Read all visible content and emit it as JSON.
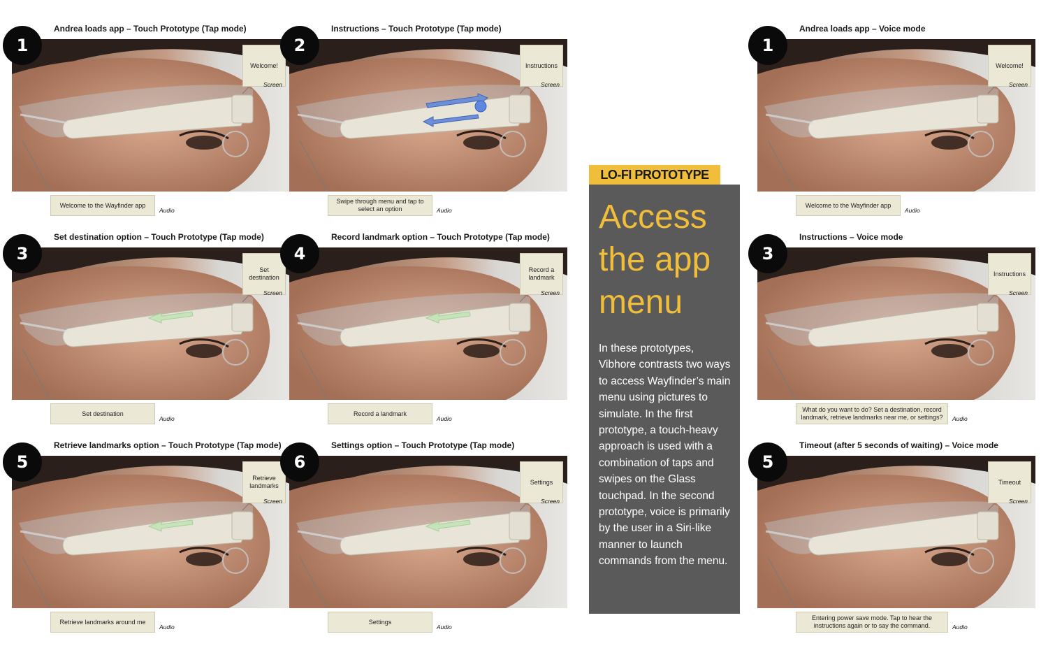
{
  "panels": [
    {
      "step": "1",
      "title": "Andrea loads app – Touch Prototype (Tap mode)",
      "screen": "Welcome!",
      "screen_caption": "Screen",
      "audio": "Welcome to the Wayfinder app",
      "audio_caption": "Audio",
      "gesture": "none"
    },
    {
      "step": "2",
      "title": "Instructions – Touch Prototype (Tap mode)",
      "screen": "Instructions",
      "screen_caption": "Screen",
      "audio": "Swipe through menu and tap to select an option",
      "audio_caption": "Audio",
      "gesture": "swipe-and-tap"
    },
    {
      "step": "3",
      "title": "Set destination option – Touch Prototype (Tap mode)",
      "screen": "Set destination",
      "screen_caption": "Screen",
      "audio": "Set destination",
      "audio_caption": "Audio",
      "gesture": "swipe-back"
    },
    {
      "step": "4",
      "title": "Record landmark option – Touch Prototype (Tap mode)",
      "screen": "Record a landmark",
      "screen_caption": "Screen",
      "audio": "Record a landmark",
      "audio_caption": "Audio",
      "gesture": "swipe-back"
    },
    {
      "step": "5",
      "title": "Retrieve landmarks option – Touch Prototype (Tap mode)",
      "screen": "Retrieve landmarks",
      "screen_caption": "Screen",
      "audio": "Retrieve landmarks around me",
      "audio_caption": "Audio",
      "gesture": "swipe-back"
    },
    {
      "step": "6",
      "title": "Settings option – Touch Prototype (Tap mode)",
      "screen": "Settings",
      "screen_caption": "Screen",
      "audio": "Settings",
      "audio_caption": "Audio",
      "gesture": "swipe-back"
    }
  ],
  "voice_panels": [
    {
      "step": "1",
      "title": "Andrea loads app – Voice mode",
      "screen": "Welcome!",
      "screen_caption": "Screen",
      "audio": "Welcome to the Wayfinder app",
      "audio_caption": "Audio"
    },
    {
      "step": "3",
      "title": "Instructions – Voice mode",
      "screen": "Instructions",
      "screen_caption": "Screen",
      "audio": "What do you want to do? Set a destination, record landmark, retrieve landmarks near me, or settings?",
      "audio_caption": "Audio"
    },
    {
      "step": "5",
      "title": "Timeout (after 5 seconds of waiting) – Voice mode",
      "screen": "Timeout",
      "screen_caption": "Screen",
      "audio": "Entering power save mode. Tap to hear the instructions again or to say the command.",
      "audio_caption": "Audio"
    }
  ],
  "card": {
    "label": "LO-FI PROTOTYPE",
    "title": "Access the app menu",
    "text": "In these prototypes, Vibhore contrasts two ways to access Wayfinder’s main menu using pictures to simulate. In the first prototype, a touch-heavy approach is used with a combination of taps and swipes on the Glass touchpad. In the second prototype, voice is primarily by the user in a Siri-like manner to launch commands from the menu.",
    "colors": {
      "accent": "#f0be3a",
      "card_bg": "#5a5a5a"
    }
  }
}
